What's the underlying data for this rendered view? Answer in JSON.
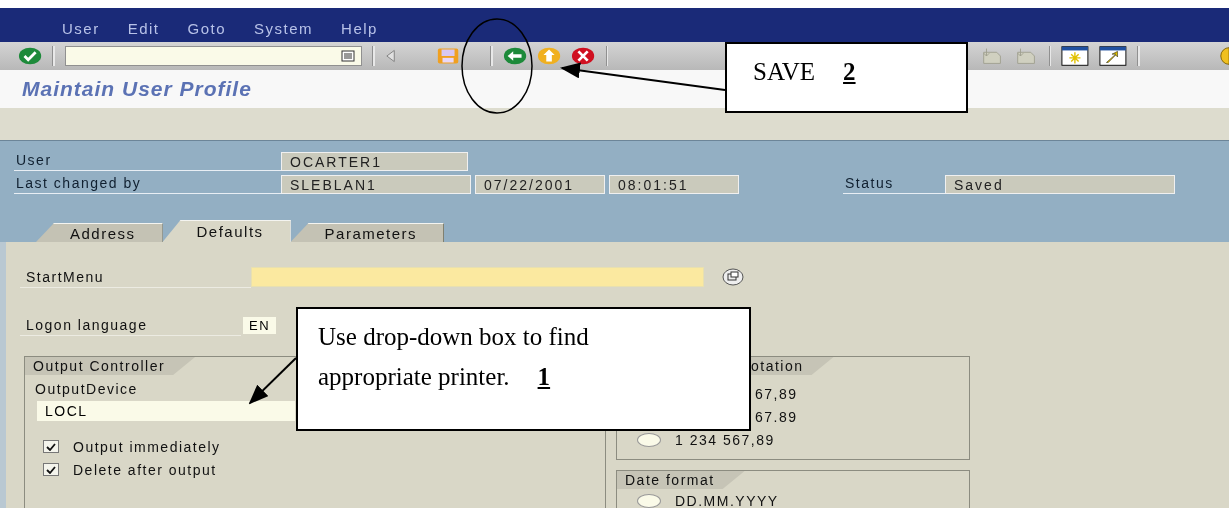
{
  "menu": [
    "User",
    "Edit",
    "Goto",
    "System",
    "Help"
  ],
  "title": "Maintain User Profile",
  "header": {
    "user": {
      "label": "User",
      "value": "OCARTER1"
    },
    "last_changed": {
      "label": "Last changed by",
      "value": "SLEBLAN1",
      "date": "07/22/2001",
      "time": "08:01:51"
    },
    "status": {
      "label": "Status",
      "value": "Saved"
    }
  },
  "tabs": [
    {
      "label": "Address",
      "selected": false
    },
    {
      "label": "Defaults",
      "selected": true
    },
    {
      "label": "Parameters",
      "selected": false
    }
  ],
  "start_menu": {
    "label": "StartMenu"
  },
  "logon_language": {
    "label": "Logon language",
    "value": "EN"
  },
  "output_controller": {
    "title": "Output Controller",
    "device_label": "OutputDevice",
    "device_value": "LOCL",
    "options": [
      {
        "label": "Output immediately",
        "checked": true
      },
      {
        "label": "Delete after output",
        "checked": true
      }
    ]
  },
  "decimal_notation": {
    "title": "otation",
    "options": [
      {
        "label": "67,89"
      },
      {
        "label": "67.89"
      },
      {
        "label": "1 234 567,89",
        "selected": false
      }
    ]
  },
  "date_format": {
    "title": "Date format",
    "options": [
      {
        "label": "DD.MM.YYYY",
        "selected": false
      }
    ]
  },
  "callouts": [
    {
      "text": "SAVE",
      "number": "2"
    },
    {
      "text": "Use drop-down box to find appropriate printer.",
      "number": "1"
    }
  ]
}
